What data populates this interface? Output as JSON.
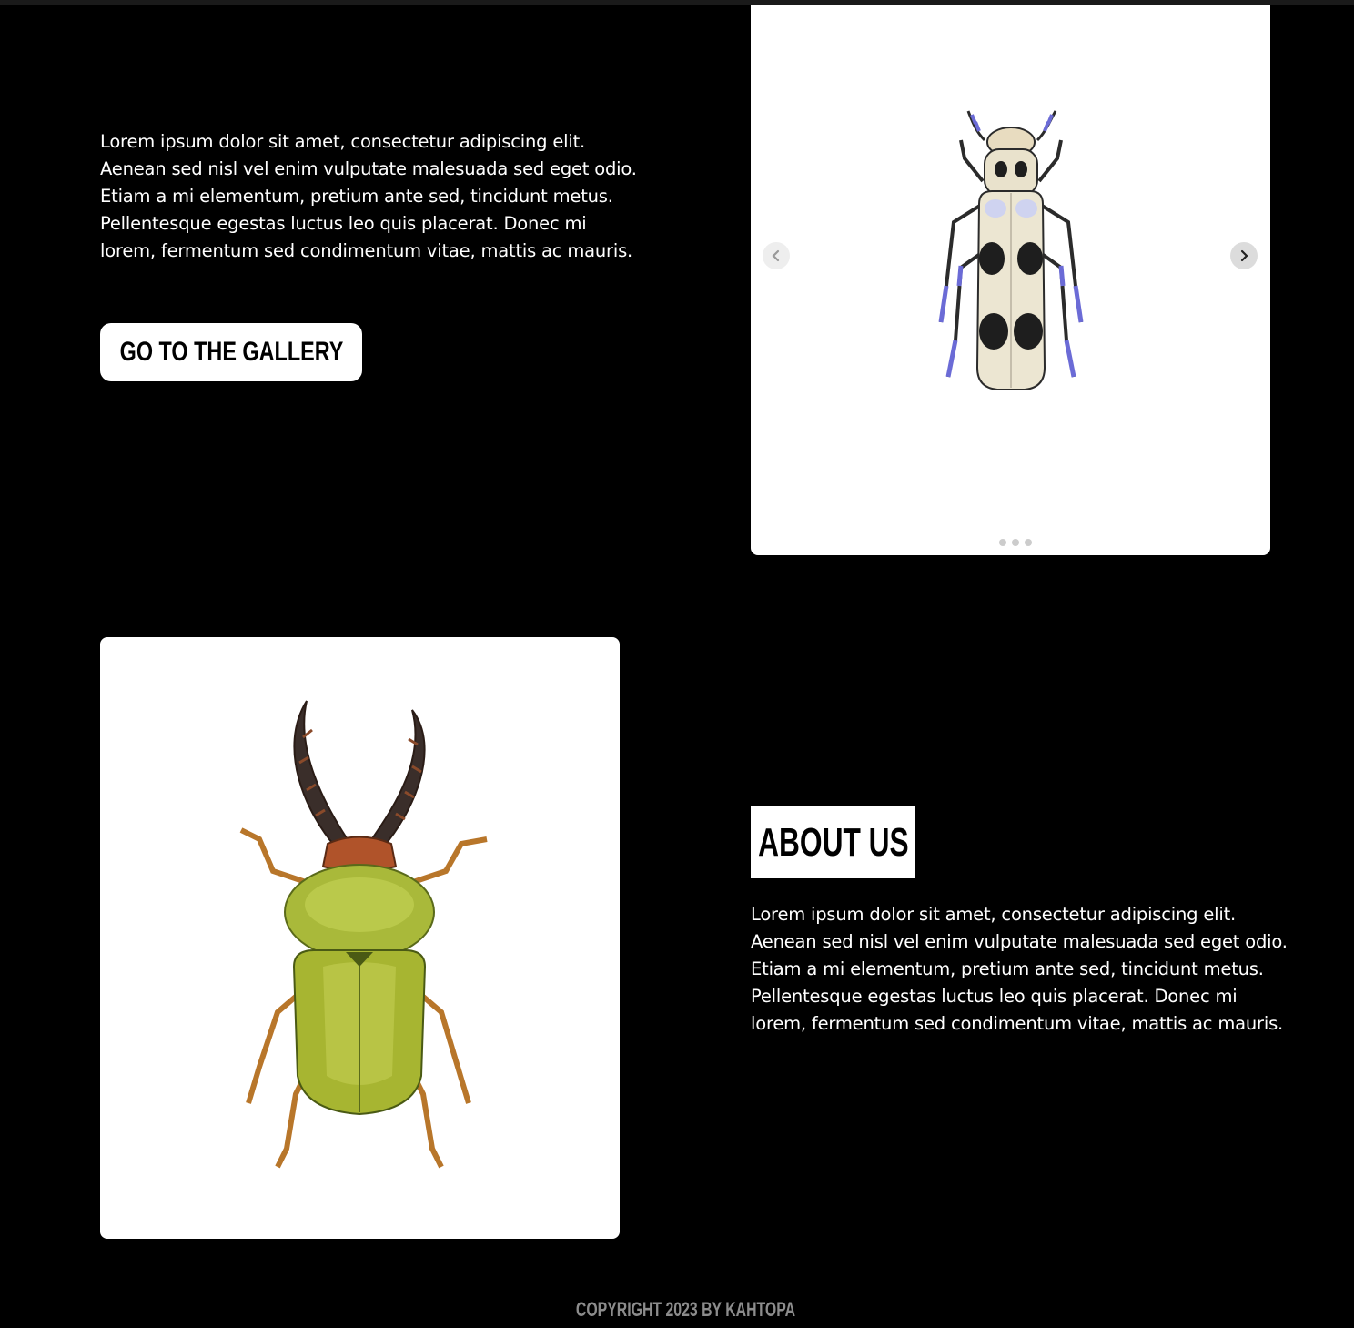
{
  "hero": {
    "paragraph": "Lorem ipsum dolor sit amet, consectetur adipiscing elit. Aenean sed nisl vel enim vulputate malesuada sed eget odio. Etiam a mi elementum, pretium ante sed, tincidunt metus. Pellentesque egestas luctus leo quis placerat. Donec mi lorem, fermentum sed condimentum vitae, mattis ac mauris.",
    "button_label": "GO TO THE GALLERY"
  },
  "slider": {
    "slide_count": 3,
    "active_slide": 1,
    "prev_icon": "chevron-left-icon",
    "next_icon": "chevron-right-icon"
  },
  "about": {
    "heading": "ABOUT US",
    "paragraph": "Lorem ipsum dolor sit amet, consectetur adipiscing elit. Aenean sed nisl vel enim vulputate malesuada sed eget odio. Etiam a mi elementum, pretium ante sed, tincidunt metus. Pellentesque egestas luctus leo quis placerat. Donec mi lorem, fermentum sed condimentum vitae, mattis ac mauris."
  },
  "footer": {
    "copyright": "COPYRIGHT 2023 BY KAHTOPA"
  },
  "colors": {
    "background": "#000000",
    "text": "#ffffff",
    "button_bg": "#ffffff",
    "footer_text": "#8c8c8c"
  }
}
